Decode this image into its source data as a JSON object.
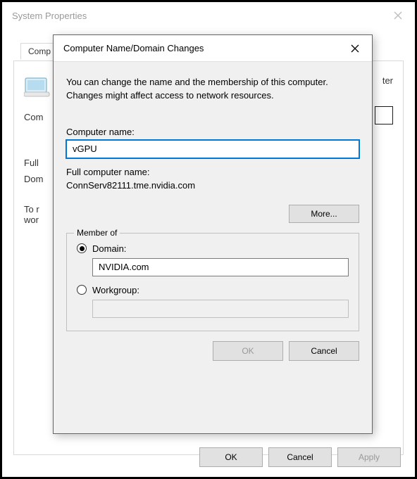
{
  "parent": {
    "title": "System Properties",
    "tab_label": "Comp",
    "description_suffix": "ter",
    "rows": {
      "com": "Com",
      "full": "Full",
      "dom": "Dom",
      "to": "To r",
      "wor": "wor"
    },
    "buttons": {
      "ok": "OK",
      "cancel": "Cancel",
      "apply": "Apply"
    }
  },
  "modal": {
    "title": "Computer Name/Domain Changes",
    "description": "You can change the name and the membership of this computer. Changes might affect access to network resources.",
    "computer_name_label": "Computer name:",
    "computer_name_value": "vGPU",
    "full_name_label": "Full computer name:",
    "full_name_value": "ConnServ82111.tme.nvidia.com",
    "more_button": "More...",
    "member_of": {
      "legend": "Member of",
      "domain_label": "Domain:",
      "domain_value": "NVIDIA.com",
      "workgroup_label": "Workgroup:",
      "workgroup_value": "",
      "selected": "domain"
    },
    "buttons": {
      "ok": "OK",
      "cancel": "Cancel"
    }
  }
}
